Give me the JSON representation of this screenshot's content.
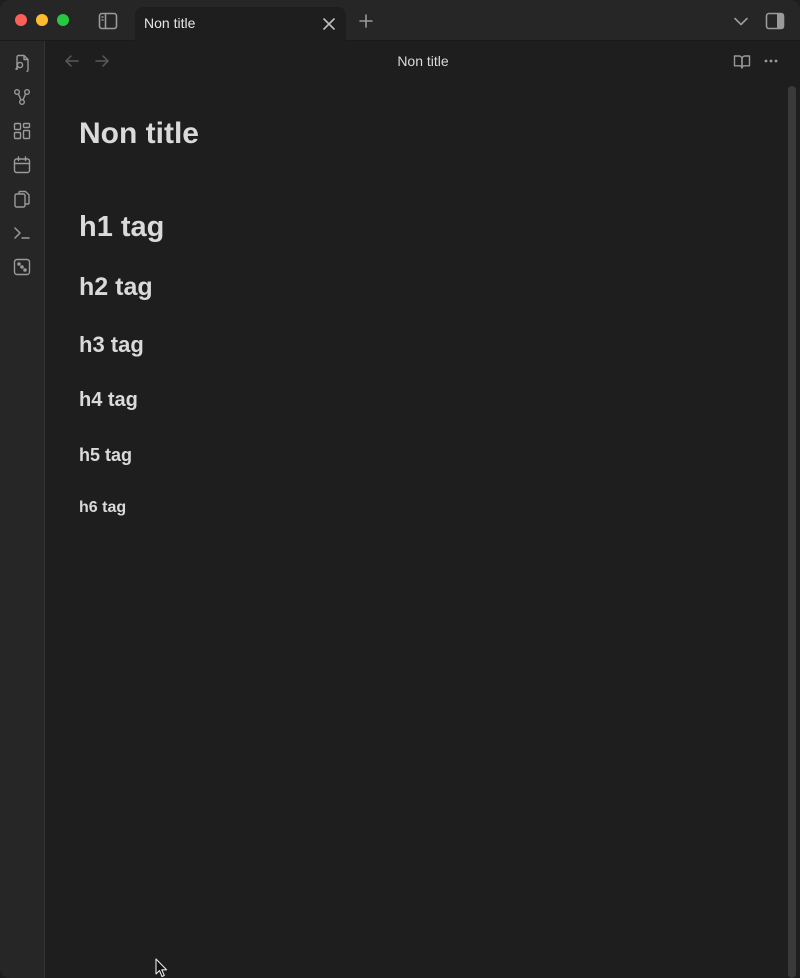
{
  "tab": {
    "title": "Non title"
  },
  "view_header": {
    "title": "Non title"
  },
  "note": {
    "title": "Non title",
    "headings": {
      "h1": "h1 tag",
      "h2": "h2 tag",
      "h3": "h3 tag",
      "h4": "h4 tag",
      "h5": "h5 tag",
      "h6": "h6 tag"
    }
  },
  "ribbon": {
    "icons": [
      "search-icon",
      "graph-view-icon",
      "canvas-icon",
      "calendar-icon",
      "templates-icon",
      "command-palette-icon",
      "random-note-icon"
    ]
  },
  "colors": {
    "background": "#1e1e1e",
    "chrome": "#262626",
    "text": "#dadada",
    "close_button": "#fe5f57",
    "minimize_button": "#febc2e",
    "zoom_button": "#28c840"
  }
}
